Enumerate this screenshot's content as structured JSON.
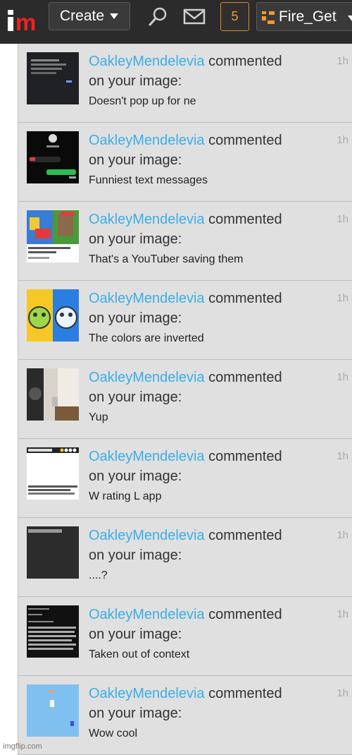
{
  "header": {
    "create_label": "Create",
    "notification_count": "5",
    "username": "Fire_Get",
    "search_icon": "search-icon",
    "mail_icon": "mail-icon"
  },
  "notifications": [
    {
      "user": "OakleyMendelevia",
      "action": "commented",
      "target": "on your image:",
      "comment": "Doesn't pop up for ne",
      "time": "1h"
    },
    {
      "user": "OakleyMendelevia",
      "action": "commented",
      "target": "on your image:",
      "comment": "Funniest text messages",
      "time": "1h"
    },
    {
      "user": "OakleyMendelevia",
      "action": "commented",
      "target": "on your image:",
      "comment": "That's a YouTuber saving them",
      "time": "1h"
    },
    {
      "user": "OakleyMendelevia",
      "action": "commented",
      "target": "on your image:",
      "comment": "The colors are inverted",
      "time": "1h"
    },
    {
      "user": "OakleyMendelevia",
      "action": "commented",
      "target": "on your image:",
      "comment": "Yup",
      "time": "1h"
    },
    {
      "user": "OakleyMendelevia",
      "action": "commented",
      "target": "on your image:",
      "comment": "W rating L app",
      "time": "1h"
    },
    {
      "user": "OakleyMendelevia",
      "action": "commented",
      "target": "on your image:",
      "comment": "....?",
      "time": "1h"
    },
    {
      "user": "OakleyMendelevia",
      "action": "commented",
      "target": "on your image:",
      "comment": "Taken out of context",
      "time": "1h"
    },
    {
      "user": "OakleyMendelevia",
      "action": "commented",
      "target": "on your image:",
      "comment": "Wow cool",
      "time": "1h"
    }
  ],
  "watermark": "imgflip.com",
  "colors": {
    "topbar": "#2b2b2b",
    "username_link": "#3aaee6",
    "notif_accent": "#e08a1e",
    "list_bg": "#e0e0e0",
    "logo_m": "#ee2222"
  }
}
